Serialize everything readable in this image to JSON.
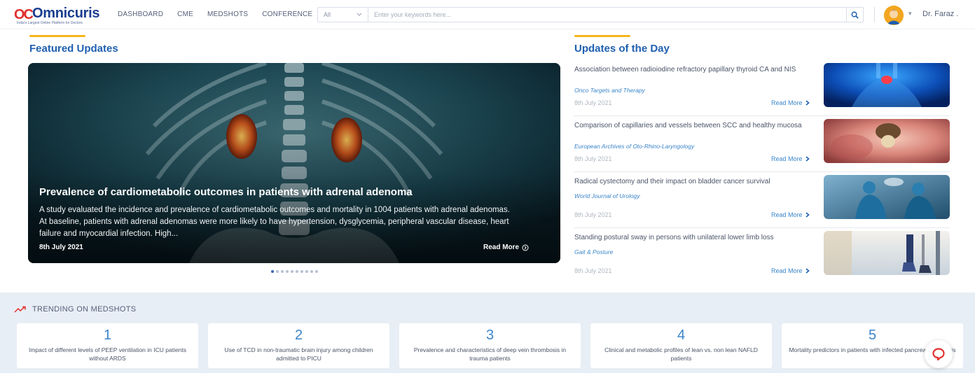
{
  "brand": {
    "mark": "OC",
    "name": "Omnicuris",
    "tagline": "India's Largest Online Platform for Doctors"
  },
  "nav": {
    "items": [
      "DASHBOARD",
      "CME",
      "MEDSHOTS",
      "CONFERENCE"
    ]
  },
  "search": {
    "category": "All",
    "placeholder": "Enter your keywords here...",
    "icon": "search-icon"
  },
  "user": {
    "name": "Dr. Faraz ."
  },
  "featured": {
    "heading": "Featured Updates",
    "title": "Prevalence of cardiometabolic outcomes in patients with adrenal adenoma",
    "description": "A study evaluated the incidence and prevalence of cardiometabolic outcomes and mortality in 1004 patients with adrenal adenomas. At baseline, patients with adrenal adenomas were more likely to have hypertension, dysglycemia, peripheral vascular disease, heart failure and myocardial infection. High...",
    "date": "8th July 2021",
    "read_more": "Read More",
    "slide_count": 10,
    "active_slide": 1
  },
  "updates": {
    "heading": "Updates of the Day",
    "items": [
      {
        "title": "Association between radioiodine refractory papillary thyroid CA and NIS",
        "journal": "Onco Targets and Therapy",
        "date": "8th July 2021",
        "read_more": "Read More"
      },
      {
        "title": "Comparison of capillaries and vessels between SCC and healthy mucosa",
        "journal": "European Archives of Oto-Rhino-Laryngology",
        "date": "8th July 2021",
        "read_more": "Read More"
      },
      {
        "title": "Radical cystectomy and their impact on bladder cancer survival",
        "journal": "World Journal of Urology",
        "date": "8th July 2021",
        "read_more": "Read More"
      },
      {
        "title": "Standing postural sway in persons with unilateral lower limb loss",
        "journal": "Gait & Posture",
        "date": "8th July 2021",
        "read_more": "Read More"
      }
    ]
  },
  "trending": {
    "heading": "TRENDING ON MEDSHOTS",
    "items": [
      {
        "rank": "1",
        "title": "Impact of different levels of PEEP ventilation in ICU patients without ARDS"
      },
      {
        "rank": "2",
        "title": "Use of TCD in non-traumatic brain injury among children admitted to PICU"
      },
      {
        "rank": "3",
        "title": "Prevalence and characteristics of deep vein thrombosis in trauma patients"
      },
      {
        "rank": "4",
        "title": "Clinical and metabolic profiles of lean vs. non lean NAFLD patients"
      },
      {
        "rank": "5",
        "title": "Mortality predictors in patients with infected pancreatic necrosis"
      }
    ]
  },
  "colors": {
    "brand_blue": "#1a3d8f",
    "brand_red": "#e0312f",
    "accent_blue": "#1f5fb0",
    "link_blue": "#3a85c9",
    "accent_yellow": "#f5b81c",
    "trending_bg": "#e8eef5"
  }
}
